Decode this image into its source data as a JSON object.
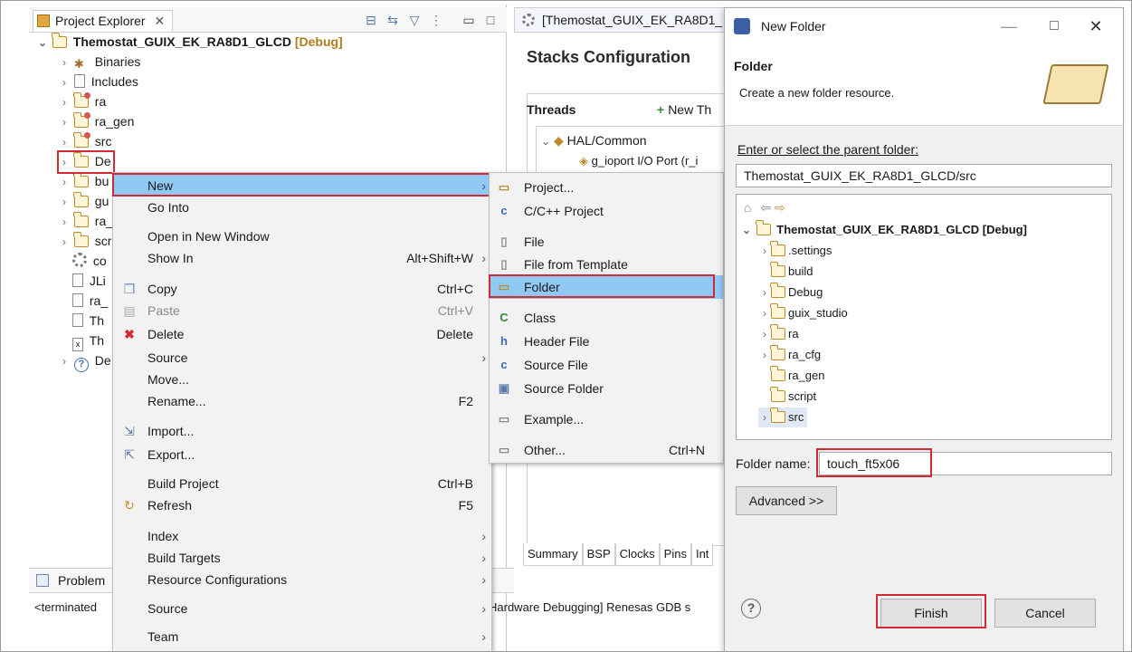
{
  "project_explorer": {
    "tab_label": "Project Explorer",
    "root": "Themostat_GUIX_EK_RA8D1_GLCD",
    "root_suffix": "[Debug]",
    "items": [
      {
        "label": "Binaries"
      },
      {
        "label": "Includes"
      },
      {
        "label": "ra"
      },
      {
        "label": "ra_gen"
      },
      {
        "label": "src"
      },
      {
        "label": "De"
      },
      {
        "label": "bu"
      },
      {
        "label": "gu"
      },
      {
        "label": "ra_"
      },
      {
        "label": "scr"
      },
      {
        "label": "co"
      },
      {
        "label": "JLi"
      },
      {
        "label": "ra_"
      },
      {
        "label": "Th"
      },
      {
        "label": "Th"
      },
      {
        "label": "De"
      }
    ]
  },
  "context_menu": {
    "items": [
      {
        "label": "New"
      },
      {
        "label": "Go Into"
      },
      {
        "label": "Open in New Window"
      },
      {
        "label": "Show In",
        "shortcut": "Alt+Shift+W"
      },
      {
        "label": "Copy",
        "shortcut": "Ctrl+C"
      },
      {
        "label": "Paste",
        "shortcut": "Ctrl+V"
      },
      {
        "label": "Delete",
        "shortcut": "Delete"
      },
      {
        "label": "Source"
      },
      {
        "label": "Move..."
      },
      {
        "label": "Rename...",
        "shortcut": "F2"
      },
      {
        "label": "Import..."
      },
      {
        "label": "Export..."
      },
      {
        "label": "Build Project",
        "shortcut": "Ctrl+B"
      },
      {
        "label": "Refresh",
        "shortcut": "F5"
      },
      {
        "label": "Index"
      },
      {
        "label": "Build Targets"
      },
      {
        "label": "Resource Configurations"
      },
      {
        "label": "Source"
      },
      {
        "label": "Team"
      }
    ]
  },
  "new_submenu": {
    "items": [
      {
        "label": "Project..."
      },
      {
        "label": "C/C++ Project"
      },
      {
        "label": "File"
      },
      {
        "label": "File from Template"
      },
      {
        "label": "Folder"
      },
      {
        "label": "Class"
      },
      {
        "label": "Header File"
      },
      {
        "label": "Source File"
      },
      {
        "label": "Source Folder"
      },
      {
        "label": "Example..."
      },
      {
        "label": "Other...",
        "shortcut": "Ctrl+N"
      }
    ]
  },
  "editor": {
    "tab_label": "[Themostat_GUIX_EK_RA8D1_",
    "title": "Stacks Configuration",
    "threads_label": "Threads",
    "new_thread_label": "New Th",
    "hal_node": "HAL/Common",
    "ioport_node": "g_ioport I/O Port (r_i",
    "bottom_tabs": [
      "Summary",
      "BSP",
      "Clocks",
      "Pins",
      "Int"
    ]
  },
  "problems": {
    "tab_label": "Problem",
    "console_left": "<terminated",
    "console_right": "Hardware Debugging] Renesas GDB s"
  },
  "dialog": {
    "window_title": "New Folder",
    "header_title": "Folder",
    "header_desc": "Create a new folder resource.",
    "parent_label": "Enter or select the parent folder:",
    "parent_value": "Themostat_GUIX_EK_RA8D1_GLCD/src",
    "tree_root": "Themostat_GUIX_EK_RA8D1_GLCD [Debug]",
    "tree_items": [
      {
        "label": ".settings"
      },
      {
        "label": "build"
      },
      {
        "label": "Debug"
      },
      {
        "label": "guix_studio"
      },
      {
        "label": "ra"
      },
      {
        "label": "ra_cfg"
      },
      {
        "label": "ra_gen"
      },
      {
        "label": "script"
      },
      {
        "label": "src"
      }
    ],
    "folder_name_label": "Folder name:",
    "folder_name_value": "touch_ft5x06",
    "advanced_label": "Advanced >>",
    "finish_label": "Finish",
    "cancel_label": "Cancel"
  },
  "colors": {
    "highlight": "#90c8f6",
    "annotation": "#d22b36"
  }
}
